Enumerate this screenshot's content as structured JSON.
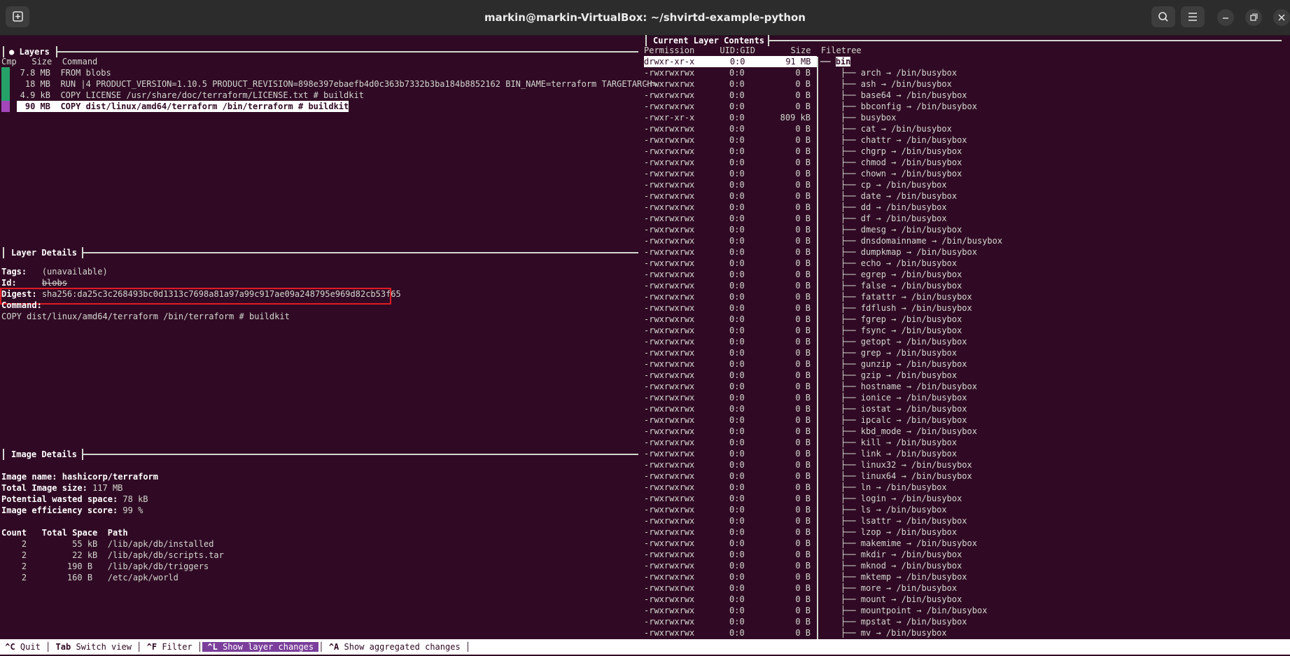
{
  "window": {
    "title": "markin@markin-VirtualBox: ~/shvirtd-example-python"
  },
  "layers": {
    "title": "Layers",
    "bullet": "●",
    "header": "Cmp   Size  Command",
    "rows": [
      {
        "size": "7.8 MB",
        "command": "FROM blobs",
        "color": "#26a269"
      },
      {
        "size": "18 MB",
        "command": "RUN |4 PRODUCT_VERSION=1.10.5 PRODUCT_REVISION=898e397ebaefb4d0c363b7332b3ba184b8852162 BIN_NAME=terraform TARGETARCH=",
        "color": "#26a269"
      },
      {
        "size": "4.9 kB",
        "command": "COPY LICENSE /usr/share/doc/terraform/LICENSE.txt # buildkit",
        "color": "#26a269"
      },
      {
        "size": "90 MB",
        "command": "COPY dist/linux/amd64/terraform /bin/terraform # buildkit",
        "color": "#a347ba"
      }
    ]
  },
  "layer_details": {
    "title": "Layer Details",
    "tags_label": "Tags:",
    "tags_value": "(unavailable)",
    "id_label": "Id:",
    "id_value": "blobs",
    "digest_label": "Digest:",
    "digest_value": "sha256:da25c3c268493bc0d1313c7698a81a97a99c917ae09a248795e969d82cb53f65",
    "command_label": "Command:",
    "command_value": "COPY dist/linux/amd64/terraform /bin/terraform # buildkit"
  },
  "image_details": {
    "title": "Image Details",
    "image_name_label": "Image name:",
    "image_name": "hashicorp/terraform",
    "total_size_label": "Total Image size:",
    "total_size": "117 MB",
    "wasted_label": "Potential wasted space:",
    "wasted": "78 kB",
    "efficiency_label": "Image efficiency score:",
    "efficiency": "99 %",
    "table_header": "Count   Total Space  Path",
    "rows": [
      "    2         55 kB  /lib/apk/db/installed",
      "    2         22 kB  /lib/apk/db/scripts.tar",
      "    2        190 B   /lib/apk/db/triggers",
      "    2        160 B   /etc/apk/world"
    ]
  },
  "contents": {
    "title": "Current Layer Contents",
    "header": "Permission     UID:GID       Size  Filetree",
    "root": {
      "perm": "drwxr-xr-x",
      "uid": "0:0",
      "size": "91 MB",
      "name": "bin"
    },
    "rows": [
      {
        "perm": "-rwxrwxrwx",
        "uid": "0:0",
        "size": "0 B",
        "name": "arch → /bin/busybox"
      },
      {
        "perm": "-rwxrwxrwx",
        "uid": "0:0",
        "size": "0 B",
        "name": "ash → /bin/busybox"
      },
      {
        "perm": "-rwxrwxrwx",
        "uid": "0:0",
        "size": "0 B",
        "name": "base64 → /bin/busybox"
      },
      {
        "perm": "-rwxrwxrwx",
        "uid": "0:0",
        "size": "0 B",
        "name": "bbconfig → /bin/busybox"
      },
      {
        "perm": "-rwxr-xr-x",
        "uid": "0:0",
        "size": "809 kB",
        "name": "busybox"
      },
      {
        "perm": "-rwxrwxrwx",
        "uid": "0:0",
        "size": "0 B",
        "name": "cat → /bin/busybox"
      },
      {
        "perm": "-rwxrwxrwx",
        "uid": "0:0",
        "size": "0 B",
        "name": "chattr → /bin/busybox"
      },
      {
        "perm": "-rwxrwxrwx",
        "uid": "0:0",
        "size": "0 B",
        "name": "chgrp → /bin/busybox"
      },
      {
        "perm": "-rwxrwxrwx",
        "uid": "0:0",
        "size": "0 B",
        "name": "chmod → /bin/busybox"
      },
      {
        "perm": "-rwxrwxrwx",
        "uid": "0:0",
        "size": "0 B",
        "name": "chown → /bin/busybox"
      },
      {
        "perm": "-rwxrwxrwx",
        "uid": "0:0",
        "size": "0 B",
        "name": "cp → /bin/busybox"
      },
      {
        "perm": "-rwxrwxrwx",
        "uid": "0:0",
        "size": "0 B",
        "name": "date → /bin/busybox"
      },
      {
        "perm": "-rwxrwxrwx",
        "uid": "0:0",
        "size": "0 B",
        "name": "dd → /bin/busybox"
      },
      {
        "perm": "-rwxrwxrwx",
        "uid": "0:0",
        "size": "0 B",
        "name": "df → /bin/busybox"
      },
      {
        "perm": "-rwxrwxrwx",
        "uid": "0:0",
        "size": "0 B",
        "name": "dmesg → /bin/busybox"
      },
      {
        "perm": "-rwxrwxrwx",
        "uid": "0:0",
        "size": "0 B",
        "name": "dnsdomainname → /bin/busybox"
      },
      {
        "perm": "-rwxrwxrwx",
        "uid": "0:0",
        "size": "0 B",
        "name": "dumpkmap → /bin/busybox"
      },
      {
        "perm": "-rwxrwxrwx",
        "uid": "0:0",
        "size": "0 B",
        "name": "echo → /bin/busybox"
      },
      {
        "perm": "-rwxrwxrwx",
        "uid": "0:0",
        "size": "0 B",
        "name": "egrep → /bin/busybox"
      },
      {
        "perm": "-rwxrwxrwx",
        "uid": "0:0",
        "size": "0 B",
        "name": "false → /bin/busybox"
      },
      {
        "perm": "-rwxrwxrwx",
        "uid": "0:0",
        "size": "0 B",
        "name": "fatattr → /bin/busybox"
      },
      {
        "perm": "-rwxrwxrwx",
        "uid": "0:0",
        "size": "0 B",
        "name": "fdflush → /bin/busybox"
      },
      {
        "perm": "-rwxrwxrwx",
        "uid": "0:0",
        "size": "0 B",
        "name": "fgrep → /bin/busybox"
      },
      {
        "perm": "-rwxrwxrwx",
        "uid": "0:0",
        "size": "0 B",
        "name": "fsync → /bin/busybox"
      },
      {
        "perm": "-rwxrwxrwx",
        "uid": "0:0",
        "size": "0 B",
        "name": "getopt → /bin/busybox"
      },
      {
        "perm": "-rwxrwxrwx",
        "uid": "0:0",
        "size": "0 B",
        "name": "grep → /bin/busybox"
      },
      {
        "perm": "-rwxrwxrwx",
        "uid": "0:0",
        "size": "0 B",
        "name": "gunzip → /bin/busybox"
      },
      {
        "perm": "-rwxrwxrwx",
        "uid": "0:0",
        "size": "0 B",
        "name": "gzip → /bin/busybox"
      },
      {
        "perm": "-rwxrwxrwx",
        "uid": "0:0",
        "size": "0 B",
        "name": "hostname → /bin/busybox"
      },
      {
        "perm": "-rwxrwxrwx",
        "uid": "0:0",
        "size": "0 B",
        "name": "ionice → /bin/busybox"
      },
      {
        "perm": "-rwxrwxrwx",
        "uid": "0:0",
        "size": "0 B",
        "name": "iostat → /bin/busybox"
      },
      {
        "perm": "-rwxrwxrwx",
        "uid": "0:0",
        "size": "0 B",
        "name": "ipcalc → /bin/busybox"
      },
      {
        "perm": "-rwxrwxrwx",
        "uid": "0:0",
        "size": "0 B",
        "name": "kbd_mode → /bin/busybox"
      },
      {
        "perm": "-rwxrwxrwx",
        "uid": "0:0",
        "size": "0 B",
        "name": "kill → /bin/busybox"
      },
      {
        "perm": "-rwxrwxrwx",
        "uid": "0:0",
        "size": "0 B",
        "name": "link → /bin/busybox"
      },
      {
        "perm": "-rwxrwxrwx",
        "uid": "0:0",
        "size": "0 B",
        "name": "linux32 → /bin/busybox"
      },
      {
        "perm": "-rwxrwxrwx",
        "uid": "0:0",
        "size": "0 B",
        "name": "linux64 → /bin/busybox"
      },
      {
        "perm": "-rwxrwxrwx",
        "uid": "0:0",
        "size": "0 B",
        "name": "ln → /bin/busybox"
      },
      {
        "perm": "-rwxrwxrwx",
        "uid": "0:0",
        "size": "0 B",
        "name": "login → /bin/busybox"
      },
      {
        "perm": "-rwxrwxrwx",
        "uid": "0:0",
        "size": "0 B",
        "name": "ls → /bin/busybox"
      },
      {
        "perm": "-rwxrwxrwx",
        "uid": "0:0",
        "size": "0 B",
        "name": "lsattr → /bin/busybox"
      },
      {
        "perm": "-rwxrwxrwx",
        "uid": "0:0",
        "size": "0 B",
        "name": "lzop → /bin/busybox"
      },
      {
        "perm": "-rwxrwxrwx",
        "uid": "0:0",
        "size": "0 B",
        "name": "makemime → /bin/busybox"
      },
      {
        "perm": "-rwxrwxrwx",
        "uid": "0:0",
        "size": "0 B",
        "name": "mkdir → /bin/busybox"
      },
      {
        "perm": "-rwxrwxrwx",
        "uid": "0:0",
        "size": "0 B",
        "name": "mknod → /bin/busybox"
      },
      {
        "perm": "-rwxrwxrwx",
        "uid": "0:0",
        "size": "0 B",
        "name": "mktemp → /bin/busybox"
      },
      {
        "perm": "-rwxrwxrwx",
        "uid": "0:0",
        "size": "0 B",
        "name": "more → /bin/busybox"
      },
      {
        "perm": "-rwxrwxrwx",
        "uid": "0:0",
        "size": "0 B",
        "name": "mount → /bin/busybox"
      },
      {
        "perm": "-rwxrwxrwx",
        "uid": "0:0",
        "size": "0 B",
        "name": "mountpoint → /bin/busybox"
      },
      {
        "perm": "-rwxrwxrwx",
        "uid": "0:0",
        "size": "0 B",
        "name": "mpstat → /bin/busybox"
      },
      {
        "perm": "-rwxrwxrwx",
        "uid": "0:0",
        "size": "0 B",
        "name": "mv → /bin/busybox"
      }
    ]
  },
  "footer": {
    "items": [
      {
        "key": "^C",
        "label": "Quit"
      },
      {
        "key": "Tab",
        "label": "Switch view"
      },
      {
        "key": "^F",
        "label": "Filter"
      },
      {
        "key": "^L",
        "label": "Show layer changes"
      },
      {
        "key": "^A",
        "label": "Show aggregated changes"
      }
    ]
  },
  "colors": {
    "background": "#300a24",
    "titlebar": "#2c2c2c",
    "highlight": "#7b3f9b",
    "digest_box": "#e01b24"
  },
  "icons": {
    "new_tab": "new-tab-icon",
    "search": "search-icon",
    "menu": "hamburger-menu-icon",
    "minimize": "minimize-icon",
    "maximize": "maximize-icon",
    "close": "close-icon"
  }
}
